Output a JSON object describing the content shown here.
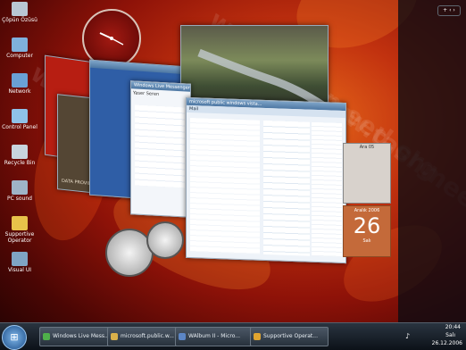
{
  "desktop": {
    "icons": [
      {
        "label": "Çöpün Özüsü",
        "icon": "recycle-bin-icon",
        "color": "#b9c7d4"
      },
      {
        "label": "Computer",
        "icon": "computer-icon",
        "color": "#7fb0dc"
      },
      {
        "label": "Network",
        "icon": "network-icon",
        "color": "#6aa0d6"
      },
      {
        "label": "Control Panel",
        "icon": "control-panel-icon",
        "color": "#8fc1e8"
      },
      {
        "label": "Recycle Bin",
        "icon": "recycle-bin-icon",
        "color": "#c8d4dd"
      },
      {
        "label": "PC sound",
        "icon": "speaker-icon",
        "color": "#9fb4c7"
      },
      {
        "label": "Supportive Operator",
        "icon": "operator-icon",
        "color": "#e8c24a"
      },
      {
        "label": "Visual UI",
        "icon": "visual-ui-icon",
        "color": "#7fa4c4"
      }
    ],
    "watermark": "www.tashmeed.org"
  },
  "windows": {
    "messenger_title": "Windows Live Messenger",
    "messenger_user": "Yaser Seren",
    "explorer_title": "microsoft public windows vista...",
    "explorer_pane_title": "Mail",
    "photo_caption": "",
    "data_panel_label": "DATA PROVIDERS"
  },
  "gadgets": {
    "calendar_month_top": "Ara 05",
    "calendar_month": "Aralık 2006",
    "calendar_day": "26",
    "calendar_weekday": "Salı"
  },
  "taskbar": {
    "buttons": [
      {
        "label": "Windows Live Mess...",
        "icon": "messenger-icon",
        "color": "#4fb04a"
      },
      {
        "label": "microsoft.public.w...",
        "icon": "mail-icon",
        "color": "#d9b04a"
      },
      {
        "label": "WAlbum II - Micro...",
        "icon": "album-icon",
        "color": "#5c86c6"
      },
      {
        "label": "Supportive Operat...",
        "icon": "operator-icon",
        "color": "#e0a530"
      }
    ],
    "clock_time": "Salı",
    "clock_date": "26.12.2006",
    "clock_hour": "20:44"
  }
}
